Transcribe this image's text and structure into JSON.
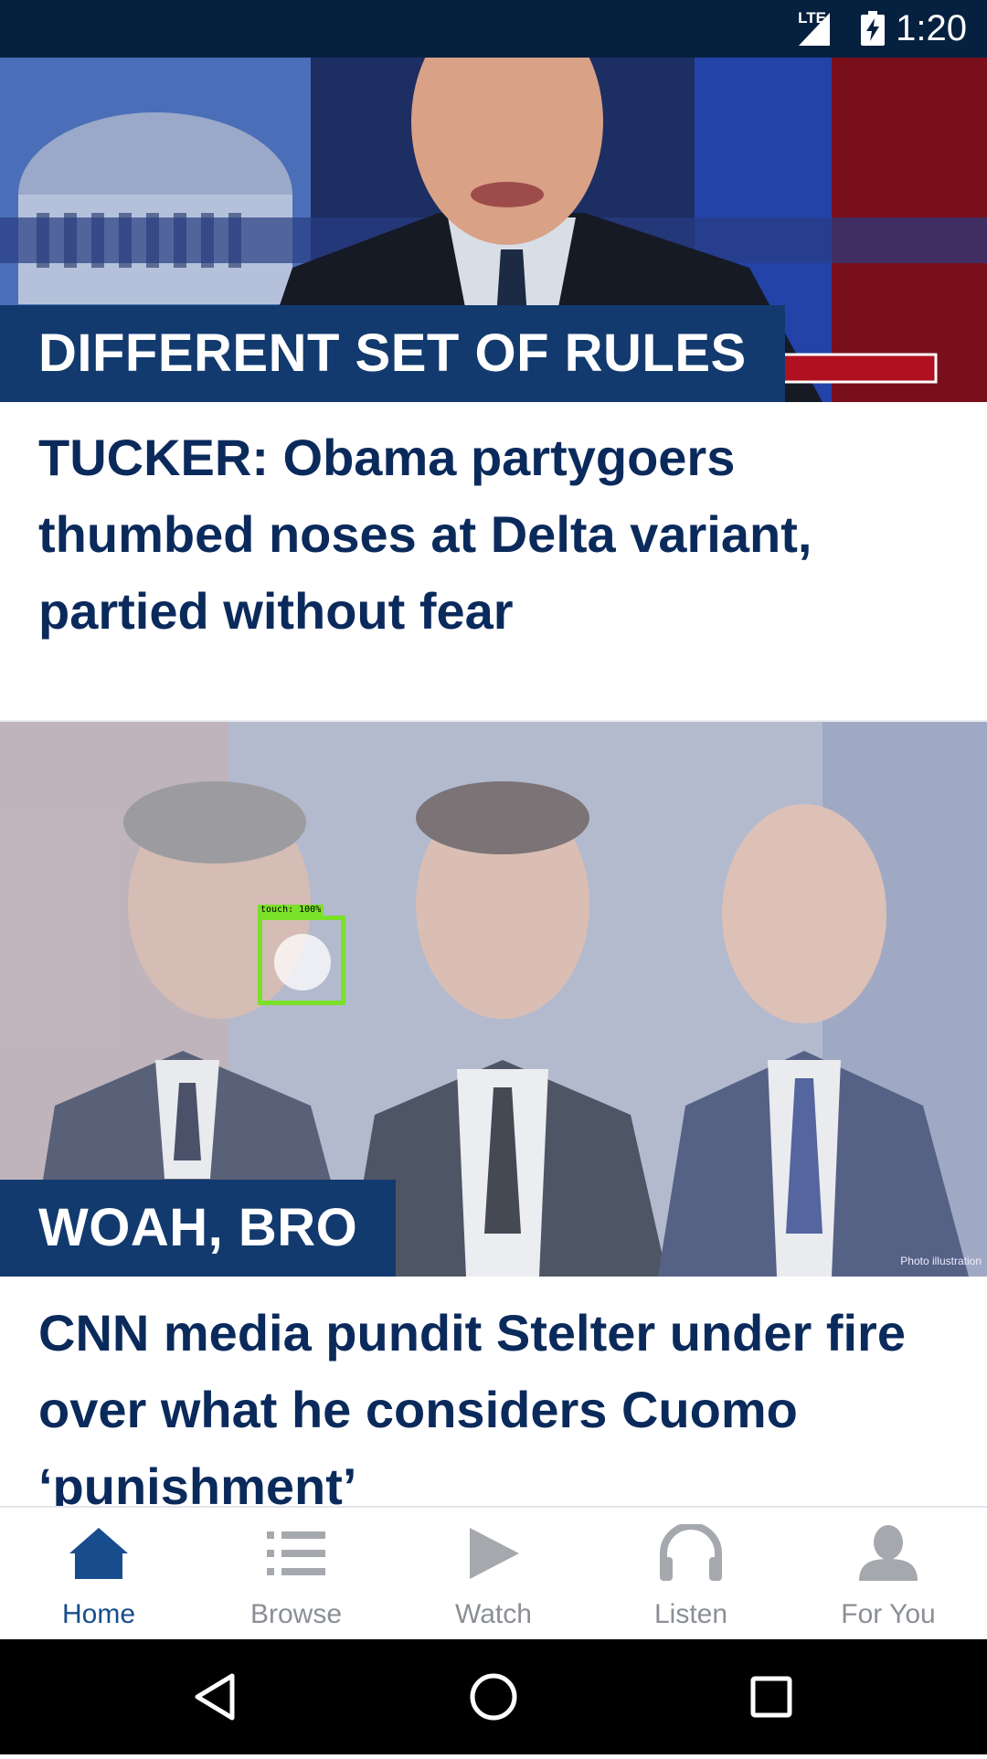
{
  "status_bar": {
    "time": "1:20",
    "network": "LTE"
  },
  "stories": [
    {
      "kicker": "DIFFERENT SET OF RULES",
      "headline": "TUCKER: Obama partygoers thumbed noses at Delta variant, partied without fear"
    },
    {
      "kicker": "WOAH, BRO",
      "headline": "CNN media pundit Stelter under fire over what he considers Cuomo ‘punishment’",
      "photo_credit": "Photo illustration"
    }
  ],
  "touch_overlay": {
    "label": "touch: 100%"
  },
  "bottom_nav": {
    "items": [
      {
        "label": "Home",
        "icon": "home-icon",
        "active": true
      },
      {
        "label": "Browse",
        "icon": "list-icon",
        "active": false
      },
      {
        "label": "Watch",
        "icon": "play-icon",
        "active": false
      },
      {
        "label": "Listen",
        "icon": "headphones-icon",
        "active": false
      },
      {
        "label": "For You",
        "icon": "person-icon",
        "active": false
      }
    ]
  },
  "colors": {
    "status_bar": "#06213f",
    "kicker_bg": "#123a6e",
    "headline": "#0b2a5c",
    "nav_active": "#174d8c",
    "nav_inactive": "#8b8f95"
  }
}
